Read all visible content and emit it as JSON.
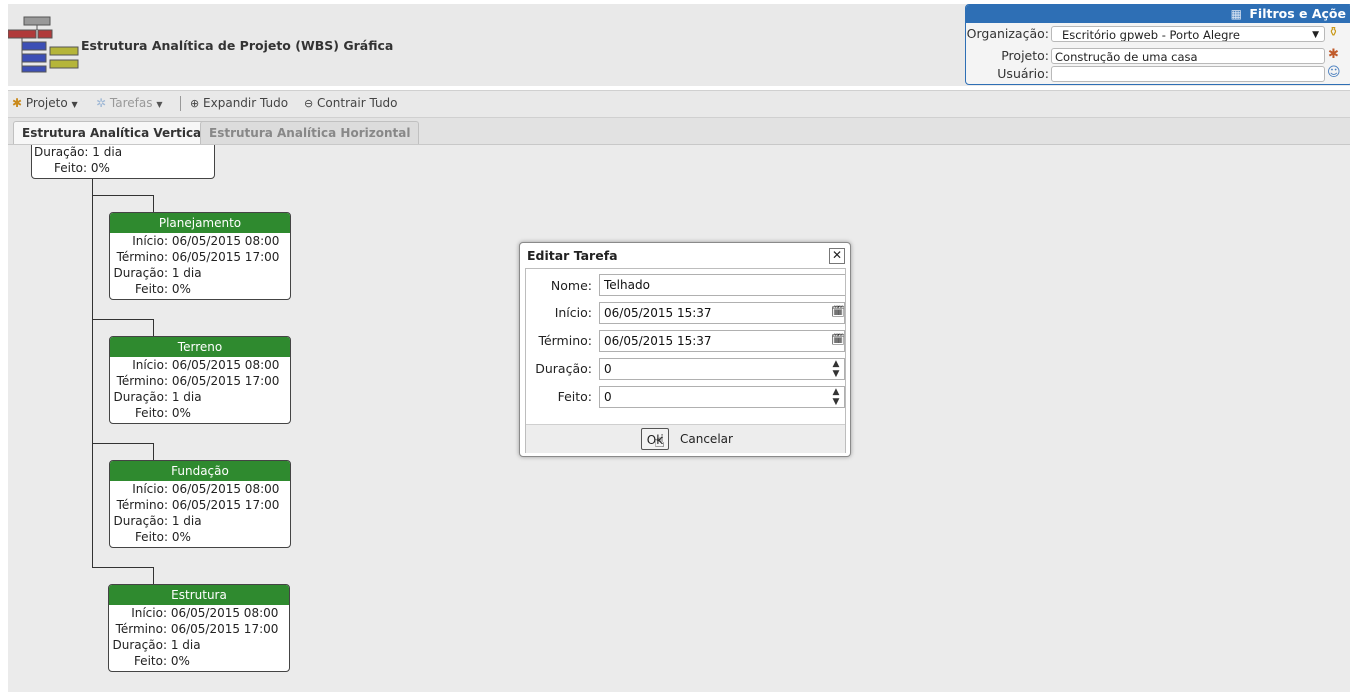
{
  "header": {
    "title": "Estrutura Analítica de Projeto (WBS) Gráfica",
    "filters": {
      "title": "Filtros e Açõe",
      "organization_label": "Organização:",
      "organization_value": "Escritório gpweb - Porto Alegre",
      "project_label": "Projeto:",
      "project_value": "Construção de uma casa",
      "user_label": "Usuário:",
      "user_value": ""
    }
  },
  "toolbar": {
    "project": "Projeto",
    "tasks": "Tarefas",
    "expand_all": "Expandir Tudo",
    "collapse_all": "Contrair Tudo"
  },
  "tabs": [
    "Estrutura Analítica Vertical",
    "Estrutura Analítica Horizontal"
  ],
  "labels": {
    "start": "Início:",
    "end": "Término:",
    "duration": "Duração:",
    "done": "Feito:"
  },
  "root_node": {
    "duration": "1 dia",
    "done": "0%"
  },
  "nodes": [
    {
      "title": "Planejamento",
      "start": "06/05/2015 08:00",
      "end": "06/05/2015 17:00",
      "duration": "1 dia",
      "done": "0%"
    },
    {
      "title": "Terreno",
      "start": "06/05/2015 08:00",
      "end": "06/05/2015 17:00",
      "duration": "1 dia",
      "done": "0%"
    },
    {
      "title": "Fundação",
      "start": "06/05/2015 08:00",
      "end": "06/05/2015 17:00",
      "duration": "1 dia",
      "done": "0%"
    },
    {
      "title": "Estrutura",
      "start": "06/05/2015 08:00",
      "end": "06/05/2015 17:00",
      "duration": "1 dia",
      "done": "0%"
    }
  ],
  "dialog": {
    "title": "Editar Tarefa",
    "name_label": "Nome:",
    "name_value": "Telhado",
    "start_label": "Início:",
    "start_value": "06/05/2015 15:37",
    "end_label": "Término:",
    "end_value": "06/05/2015 15:37",
    "duration_label": "Duração:",
    "duration_value": "0",
    "done_label": "Feito:",
    "done_value": "0",
    "ok": "Ok",
    "cancel": "Cancelar"
  },
  "colors": {
    "node_header": "#2f8a2f",
    "filters_header": "#2e6fb5",
    "canvas": "#ebebeb"
  }
}
